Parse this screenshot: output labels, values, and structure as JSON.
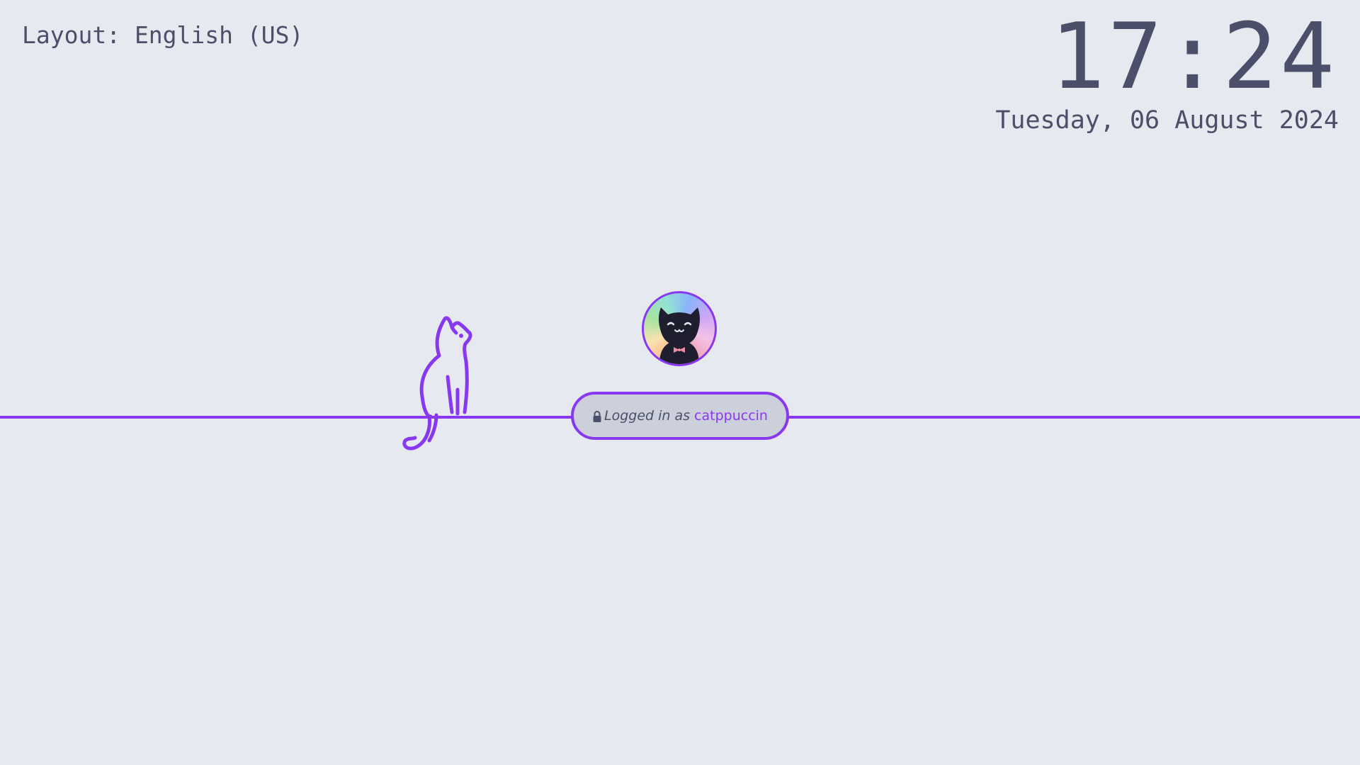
{
  "layout": {
    "label": "Layout: English (US)"
  },
  "clock": {
    "time": "17:24",
    "date": "Tuesday, 06 August 2024"
  },
  "login": {
    "prefix": "Logged in as",
    "username": "catppuccin"
  },
  "icons": {
    "lock": "lock-icon",
    "avatar": "cat-avatar",
    "decoration": "cat-outline"
  },
  "colors": {
    "background": "#e6e9ef",
    "accent": "#8839ef",
    "text": "#4c4f69",
    "pill_background": "#ccd0da"
  }
}
